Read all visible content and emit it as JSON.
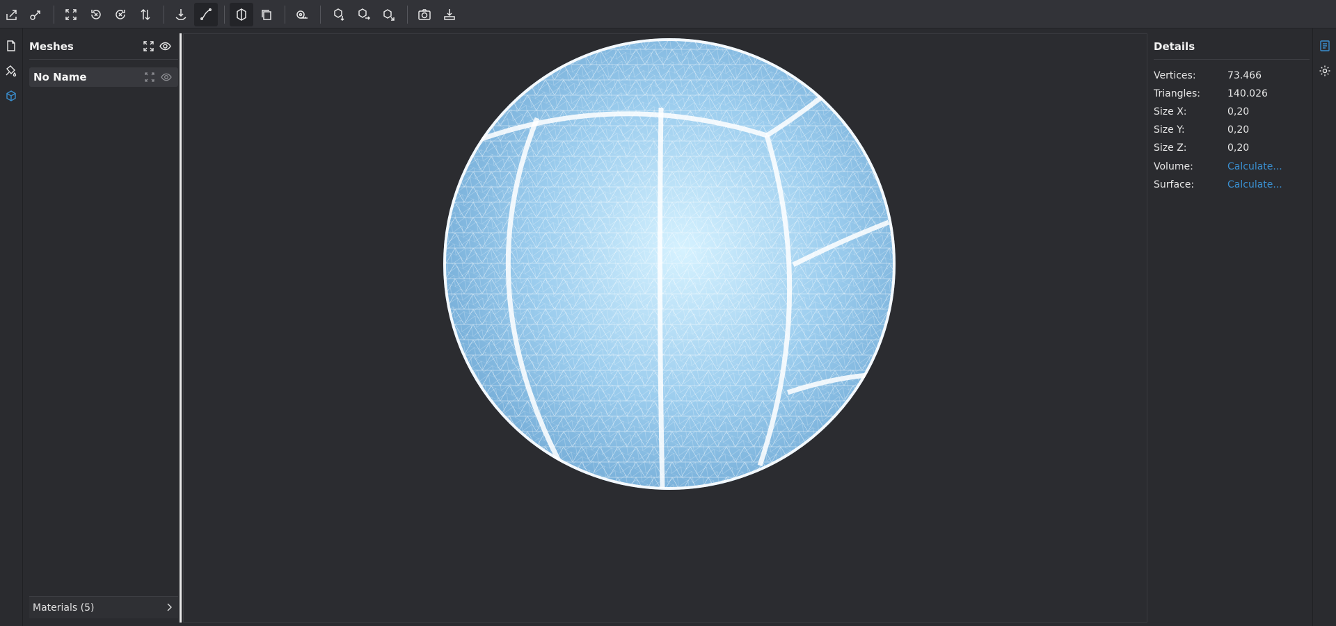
{
  "toolbar": {
    "buttons": [
      {
        "name": "import-icon",
        "tooltip": ""
      },
      {
        "name": "export-icon",
        "tooltip": ""
      },
      {
        "name": "fit-view-icon",
        "tooltip": ""
      },
      {
        "name": "rotate-left-icon",
        "tooltip": ""
      },
      {
        "name": "rotate-right-icon",
        "tooltip": ""
      },
      {
        "name": "flip-icon",
        "tooltip": ""
      },
      {
        "name": "place-on-ground-icon",
        "tooltip": ""
      },
      {
        "name": "wireframe-icon",
        "tooltip": ""
      },
      {
        "name": "solid-view-icon",
        "tooltip": ""
      },
      {
        "name": "ortho-view-icon",
        "tooltip": ""
      },
      {
        "name": "measure-icon",
        "tooltip": ""
      },
      {
        "name": "view-front-icon",
        "tooltip": ""
      },
      {
        "name": "view-side-icon",
        "tooltip": ""
      },
      {
        "name": "view-top-icon",
        "tooltip": ""
      },
      {
        "name": "snapshot-icon",
        "tooltip": ""
      },
      {
        "name": "download-icon",
        "tooltip": ""
      }
    ],
    "active": "wireframe-icon"
  },
  "left_rail": {
    "items": [
      {
        "name": "file-icon",
        "active": false
      },
      {
        "name": "materials-icon",
        "active": false
      },
      {
        "name": "meshes-icon",
        "active": true
      }
    ]
  },
  "meshes_panel": {
    "title": "Meshes",
    "items": [
      {
        "label": "No Name"
      }
    ],
    "materials_label": "Materials (5)"
  },
  "details": {
    "title": "Details",
    "rows": [
      {
        "key": "Vertices:",
        "value": "73.466",
        "link": false
      },
      {
        "key": "Triangles:",
        "value": "140.026",
        "link": false
      },
      {
        "key": "Size X:",
        "value": "0,20",
        "link": false
      },
      {
        "key": "Size Y:",
        "value": "0,20",
        "link": false
      },
      {
        "key": "Size Z:",
        "value": "0,20",
        "link": false
      },
      {
        "key": "Volume:",
        "value": "Calculate...",
        "link": true
      },
      {
        "key": "Surface:",
        "value": "Calculate...",
        "link": true
      }
    ]
  },
  "right_rail": {
    "items": [
      {
        "name": "details-icon",
        "active": true
      },
      {
        "name": "settings-icon",
        "active": false
      }
    ]
  },
  "colors": {
    "accent": "#3a8fd0",
    "sphere_center": "#d6f2ff",
    "sphere_mid": "#9ccdee",
    "sphere_edge": "#6fa8d4",
    "wire": "#ffffff"
  }
}
